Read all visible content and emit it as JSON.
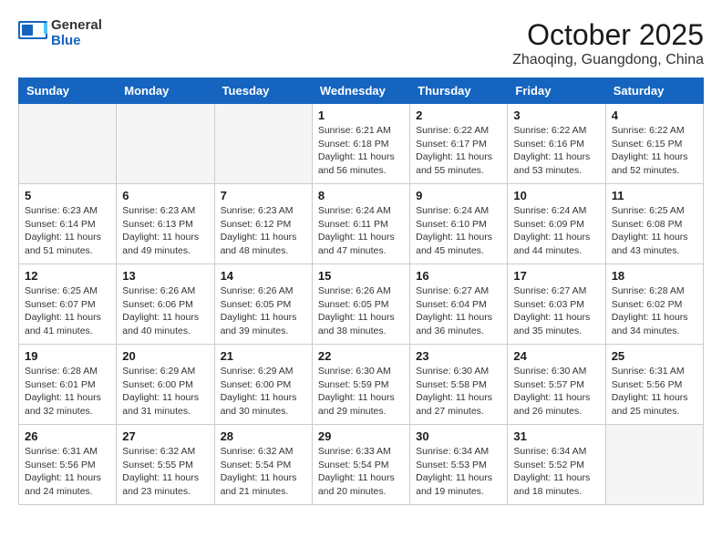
{
  "header": {
    "logo_general": "General",
    "logo_blue": "Blue",
    "month": "October 2025",
    "location": "Zhaoqing, Guangdong, China"
  },
  "weekdays": [
    "Sunday",
    "Monday",
    "Tuesday",
    "Wednesday",
    "Thursday",
    "Friday",
    "Saturday"
  ],
  "weeks": [
    [
      {
        "day": "",
        "info": ""
      },
      {
        "day": "",
        "info": ""
      },
      {
        "day": "",
        "info": ""
      },
      {
        "day": "1",
        "info": "Sunrise: 6:21 AM\nSunset: 6:18 PM\nDaylight: 11 hours\nand 56 minutes."
      },
      {
        "day": "2",
        "info": "Sunrise: 6:22 AM\nSunset: 6:17 PM\nDaylight: 11 hours\nand 55 minutes."
      },
      {
        "day": "3",
        "info": "Sunrise: 6:22 AM\nSunset: 6:16 PM\nDaylight: 11 hours\nand 53 minutes."
      },
      {
        "day": "4",
        "info": "Sunrise: 6:22 AM\nSunset: 6:15 PM\nDaylight: 11 hours\nand 52 minutes."
      }
    ],
    [
      {
        "day": "5",
        "info": "Sunrise: 6:23 AM\nSunset: 6:14 PM\nDaylight: 11 hours\nand 51 minutes."
      },
      {
        "day": "6",
        "info": "Sunrise: 6:23 AM\nSunset: 6:13 PM\nDaylight: 11 hours\nand 49 minutes."
      },
      {
        "day": "7",
        "info": "Sunrise: 6:23 AM\nSunset: 6:12 PM\nDaylight: 11 hours\nand 48 minutes."
      },
      {
        "day": "8",
        "info": "Sunrise: 6:24 AM\nSunset: 6:11 PM\nDaylight: 11 hours\nand 47 minutes."
      },
      {
        "day": "9",
        "info": "Sunrise: 6:24 AM\nSunset: 6:10 PM\nDaylight: 11 hours\nand 45 minutes."
      },
      {
        "day": "10",
        "info": "Sunrise: 6:24 AM\nSunset: 6:09 PM\nDaylight: 11 hours\nand 44 minutes."
      },
      {
        "day": "11",
        "info": "Sunrise: 6:25 AM\nSunset: 6:08 PM\nDaylight: 11 hours\nand 43 minutes."
      }
    ],
    [
      {
        "day": "12",
        "info": "Sunrise: 6:25 AM\nSunset: 6:07 PM\nDaylight: 11 hours\nand 41 minutes."
      },
      {
        "day": "13",
        "info": "Sunrise: 6:26 AM\nSunset: 6:06 PM\nDaylight: 11 hours\nand 40 minutes."
      },
      {
        "day": "14",
        "info": "Sunrise: 6:26 AM\nSunset: 6:05 PM\nDaylight: 11 hours\nand 39 minutes."
      },
      {
        "day": "15",
        "info": "Sunrise: 6:26 AM\nSunset: 6:05 PM\nDaylight: 11 hours\nand 38 minutes."
      },
      {
        "day": "16",
        "info": "Sunrise: 6:27 AM\nSunset: 6:04 PM\nDaylight: 11 hours\nand 36 minutes."
      },
      {
        "day": "17",
        "info": "Sunrise: 6:27 AM\nSunset: 6:03 PM\nDaylight: 11 hours\nand 35 minutes."
      },
      {
        "day": "18",
        "info": "Sunrise: 6:28 AM\nSunset: 6:02 PM\nDaylight: 11 hours\nand 34 minutes."
      }
    ],
    [
      {
        "day": "19",
        "info": "Sunrise: 6:28 AM\nSunset: 6:01 PM\nDaylight: 11 hours\nand 32 minutes."
      },
      {
        "day": "20",
        "info": "Sunrise: 6:29 AM\nSunset: 6:00 PM\nDaylight: 11 hours\nand 31 minutes."
      },
      {
        "day": "21",
        "info": "Sunrise: 6:29 AM\nSunset: 6:00 PM\nDaylight: 11 hours\nand 30 minutes."
      },
      {
        "day": "22",
        "info": "Sunrise: 6:30 AM\nSunset: 5:59 PM\nDaylight: 11 hours\nand 29 minutes."
      },
      {
        "day": "23",
        "info": "Sunrise: 6:30 AM\nSunset: 5:58 PM\nDaylight: 11 hours\nand 27 minutes."
      },
      {
        "day": "24",
        "info": "Sunrise: 6:30 AM\nSunset: 5:57 PM\nDaylight: 11 hours\nand 26 minutes."
      },
      {
        "day": "25",
        "info": "Sunrise: 6:31 AM\nSunset: 5:56 PM\nDaylight: 11 hours\nand 25 minutes."
      }
    ],
    [
      {
        "day": "26",
        "info": "Sunrise: 6:31 AM\nSunset: 5:56 PM\nDaylight: 11 hours\nand 24 minutes."
      },
      {
        "day": "27",
        "info": "Sunrise: 6:32 AM\nSunset: 5:55 PM\nDaylight: 11 hours\nand 23 minutes."
      },
      {
        "day": "28",
        "info": "Sunrise: 6:32 AM\nSunset: 5:54 PM\nDaylight: 11 hours\nand 21 minutes."
      },
      {
        "day": "29",
        "info": "Sunrise: 6:33 AM\nSunset: 5:54 PM\nDaylight: 11 hours\nand 20 minutes."
      },
      {
        "day": "30",
        "info": "Sunrise: 6:34 AM\nSunset: 5:53 PM\nDaylight: 11 hours\nand 19 minutes."
      },
      {
        "day": "31",
        "info": "Sunrise: 6:34 AM\nSunset: 5:52 PM\nDaylight: 11 hours\nand 18 minutes."
      },
      {
        "day": "",
        "info": ""
      }
    ]
  ]
}
